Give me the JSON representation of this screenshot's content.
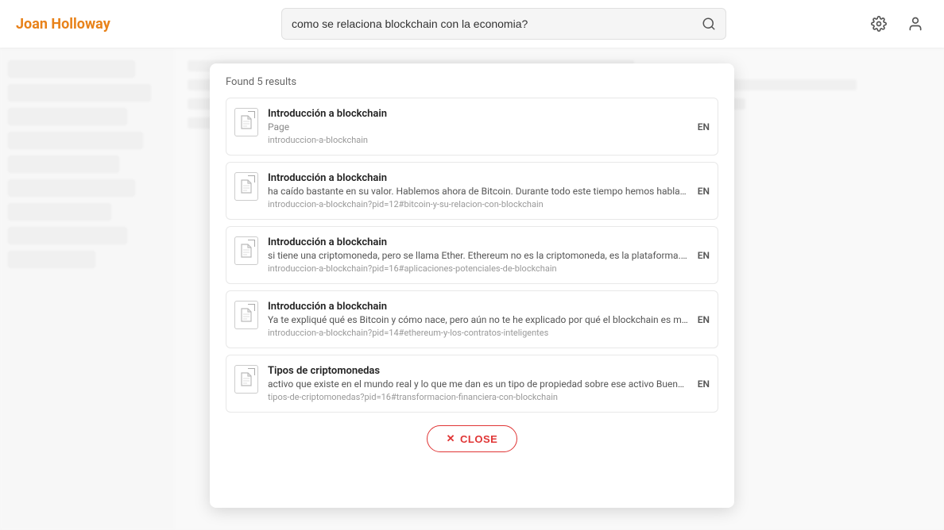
{
  "header": {
    "logo": "Joan Holloway",
    "search_placeholder": "como se relaciona blockchain con la economia?",
    "search_value": "como se relaciona blockchain con la economia?",
    "settings_icon": "gear-icon",
    "user_icon": "user-icon"
  },
  "search_results": {
    "count_label": "Found 5 results",
    "items": [
      {
        "title": "Introducción a blockchain",
        "subtitle": "Page",
        "excerpt": "",
        "url": "introduccion-a-blockchain",
        "lang": "EN",
        "type": "page"
      },
      {
        "title": "Introducción a blockchain",
        "subtitle": "",
        "excerpt": "ha caído bastante en su valor. Hablemos ahora de Bitcoin. Durante todo este tiempo hemos hablado de Blockchain relacionándolo directamente con Bi...",
        "url": "introduccion-a-blockchain?pid=12#bitcoin-y-su-relacion-con-blockchain",
        "lang": "EN",
        "type": "doc"
      },
      {
        "title": "Introducción a blockchain",
        "subtitle": "",
        "excerpt": "si tiene una criptomoneda, pero se llama Ether. Ethereum no es la criptomoneda, es la plataforma. Y para comparar con Bitcoin, en Ether la prueba de t...",
        "url": "introduccion-a-blockchain?pid=16#aplicaciones-potenciales-de-blockchain",
        "lang": "EN",
        "type": "doc"
      },
      {
        "title": "Introducción a blockchain",
        "subtitle": "",
        "excerpt": "Ya te expliqué qué es Bitcoin y cómo nace, pero aún no te he explicado por qué el blockchain es mucho más que Bitcoin y para eso tenemos que habla...",
        "url": "introduccion-a-blockchain?pid=14#ethereum-y-los-contratos-inteligentes",
        "lang": "EN",
        "type": "doc"
      },
      {
        "title": "Tipos de criptomonedas",
        "subtitle": "",
        "excerpt": "activo que existe en el mundo real y lo que me dan es un tipo de propiedad sobre ese activo Bueno, yo me gustaría terminar con una reflexión y es que...",
        "url": "tipos-de-criptomonedas?pid=16#transformacion-financiera-con-blockchain",
        "lang": "EN",
        "type": "doc"
      }
    ],
    "close_label": "CLOSE"
  }
}
